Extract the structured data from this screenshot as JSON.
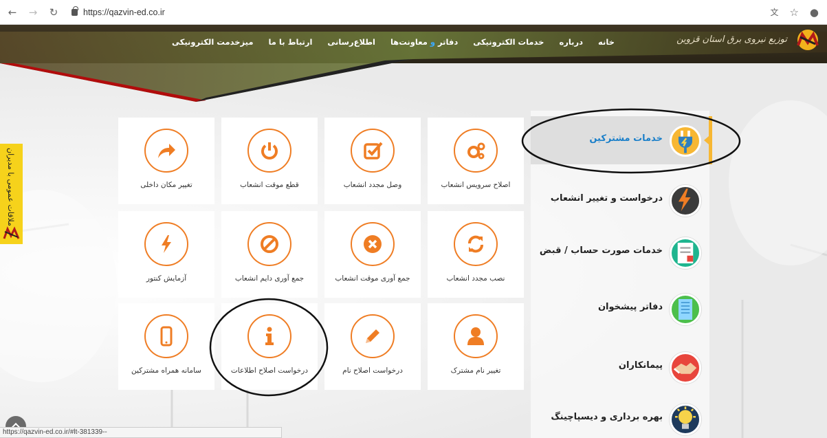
{
  "browser": {
    "url": "https://qazvin-ed.co.ir",
    "status_url": "https://qazvin-ed.co.ir/#lt-381339--"
  },
  "header": {
    "logo_text": "توزیع نیروی برق استان قزوین",
    "menu": [
      {
        "label": "خانه"
      },
      {
        "label": "درباره"
      },
      {
        "label": "خدمات الکترونیکی"
      },
      {
        "label_a": "دفاتر ",
        "label_hl": "و",
        "label_b": " معاونت‌ها"
      },
      {
        "label": "اطلاع‌رسانی"
      },
      {
        "label": "ارتباط با ما"
      },
      {
        "label": "میزخدمت الکترونیکی"
      }
    ]
  },
  "side_tab": {
    "label": "ملاقات عمومی با مدیران"
  },
  "tiles": [
    {
      "label": "اصلاح سرویس انشعاب",
      "icon": "gears-icon"
    },
    {
      "label": "وصل مجدد انشعاب",
      "icon": "checkbox-icon"
    },
    {
      "label": "قطع موقت انشعاب",
      "icon": "power-icon"
    },
    {
      "label": "تغییر مکان داخلی",
      "icon": "share-arrow-icon"
    },
    {
      "label": "نصب مجدد انشعاب",
      "icon": "refresh-icon"
    },
    {
      "label": "جمع آوری موقت انشعاب",
      "icon": "times-circle-icon"
    },
    {
      "label": "جمع آوری دایم انشعاب",
      "icon": "ban-icon"
    },
    {
      "label": "آزمایش کنتور",
      "icon": "bolt-icon"
    },
    {
      "label": "تغییر نام مشترک",
      "icon": "user-icon"
    },
    {
      "label": "درخواست اصلاح نام",
      "icon": "pencil-icon"
    },
    {
      "label": "درخواست اصلاح اطلاعات",
      "icon": "info-icon"
    },
    {
      "label": "سامانه همراه مشترکین",
      "icon": "mobile-icon"
    }
  ],
  "right_menu": [
    {
      "label": "خدمات مشترکین",
      "icon": "plug-icon",
      "active": true,
      "color": "#f7b733"
    },
    {
      "label": "درخواست و تغییر انشعاب",
      "icon": "bolt-icon",
      "color": "#3b3b3b"
    },
    {
      "label": "خدمات صورت حساب / قبض",
      "icon": "invoice-icon",
      "color": "#1fb58f"
    },
    {
      "label": "دفاتر پیشخوان",
      "icon": "building-icon",
      "color": "#4cbf4c"
    },
    {
      "label": "پیمانکاران",
      "icon": "handshake-icon",
      "color": "#e8453c"
    },
    {
      "label": "بهره برداری و دیسپاچینگ",
      "icon": "lightbulb-icon",
      "color": "#1e3a5c"
    }
  ],
  "colors": {
    "accent": "#ef7d24",
    "active_menu_text": "#1a7fc9",
    "banner": "#2a2417",
    "side_tab": "#f6d21b"
  }
}
